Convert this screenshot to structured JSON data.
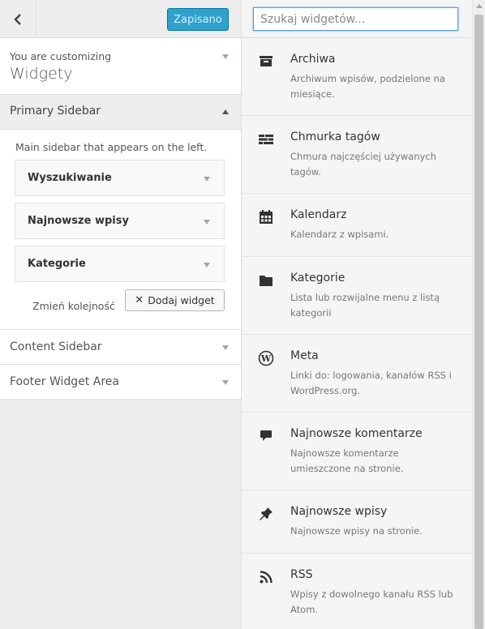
{
  "header": {
    "saved_label": "Zapisano"
  },
  "info": {
    "customizing_label": "You are customizing",
    "section_title": "Widgety"
  },
  "primary_sidebar": {
    "title": "Primary Sidebar",
    "description": "Main sidebar that appears on the left.",
    "widgets": [
      {
        "label": "Wyszukiwanie"
      },
      {
        "label": "Najnowsze wpisy"
      },
      {
        "label": "Kategorie"
      }
    ],
    "reorder_label": "Zmień kolejność",
    "add_widget_label": "Dodaj widget"
  },
  "sections": [
    {
      "title": "Content Sidebar"
    },
    {
      "title": "Footer Widget Area"
    }
  ],
  "available_widgets": {
    "search_placeholder": "Szukaj widgetów...",
    "items": [
      {
        "icon": "archive-icon",
        "title": "Archiwa",
        "description": "Archiwum wpisów, podzielone na miesiące."
      },
      {
        "icon": "tag-cloud-icon",
        "title": "Chmurka tagów",
        "description": "Chmura najczęściej używanych tagów."
      },
      {
        "icon": "calendar-icon",
        "title": "Kalendarz",
        "description": "Kalendarz z wpisami."
      },
      {
        "icon": "folder-icon",
        "title": "Kategorie",
        "description": "Lista lub rozwijalne menu z listą kategorii"
      },
      {
        "icon": "wordpress-icon",
        "title": "Meta",
        "description": "Linki do: logowania, kanałów RSS i WordPress.org."
      },
      {
        "icon": "comment-icon",
        "title": "Najnowsze komentarze",
        "description": "Najnowsze komentarze umieszczone na stronie."
      },
      {
        "icon": "pin-icon",
        "title": "Najnowsze wpisy",
        "description": "Najnowsze wpisy na stronie."
      },
      {
        "icon": "rss-icon",
        "title": "RSS",
        "description": "Wpisy z dowolnego kanału RSS lub Atom."
      }
    ]
  },
  "colors": {
    "primary_button": "#2ea2cc",
    "panel_background": "#eeeeee",
    "focus_border": "#5b9dd9"
  }
}
